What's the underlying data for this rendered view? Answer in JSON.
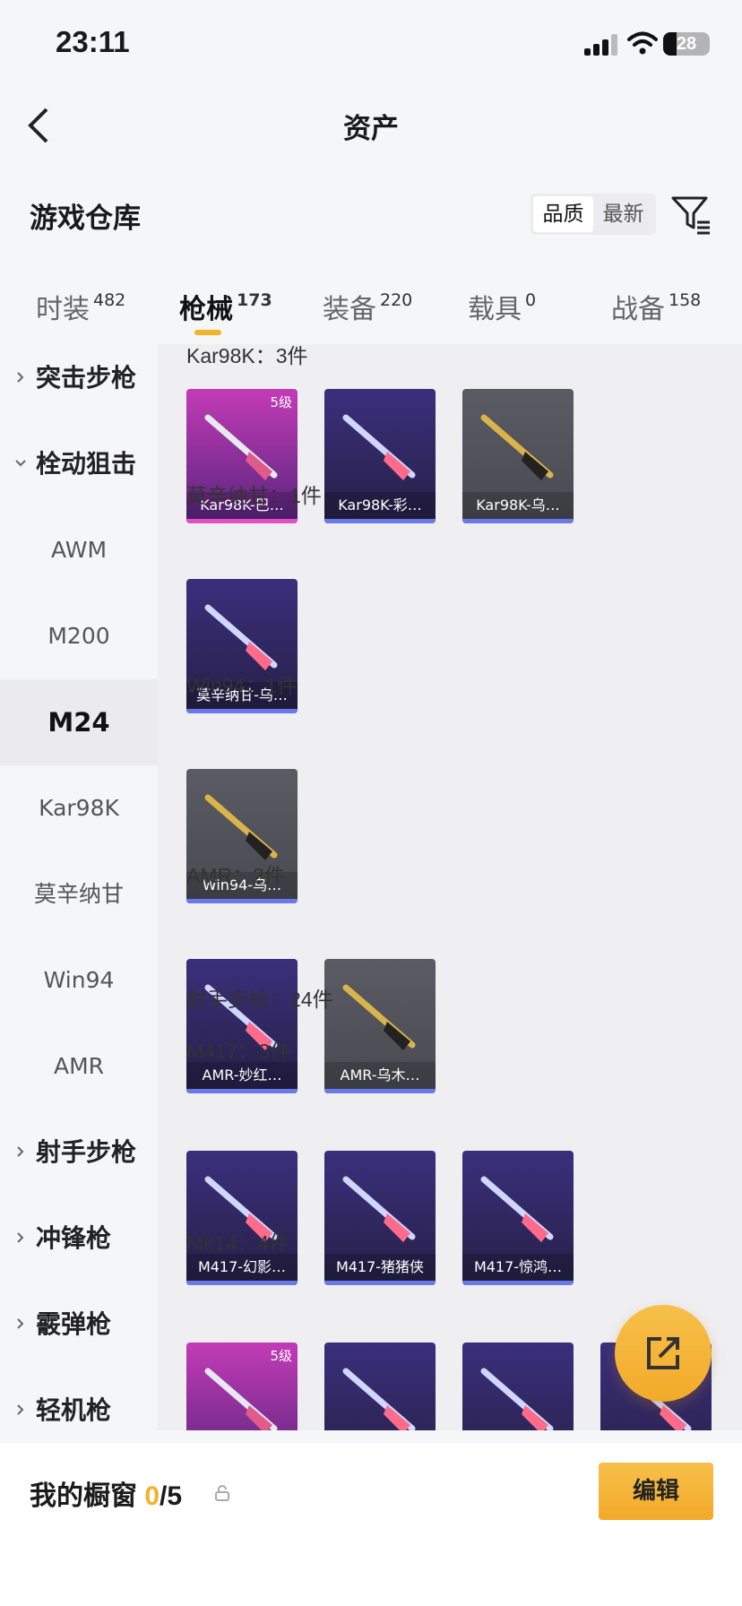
{
  "status": {
    "time": "23:11",
    "battery": "28",
    "battery_level": 0.28
  },
  "nav": {
    "title": "资产"
  },
  "section": {
    "title": "游戏仓库",
    "sort_options": [
      "品质",
      "最新"
    ],
    "sort_selected": "品质"
  },
  "tabs": [
    {
      "label": "时装",
      "count": "482"
    },
    {
      "label": "枪械",
      "count": "173",
      "active": true
    },
    {
      "label": "装备",
      "count": "220"
    },
    {
      "label": "载具",
      "count": "0"
    },
    {
      "label": "战备",
      "count": "158"
    }
  ],
  "sidebar": {
    "items": [
      {
        "label": "突击步枪",
        "type": "group",
        "expanded": false
      },
      {
        "label": "栓动狙击",
        "type": "group",
        "expanded": true
      },
      {
        "label": "AWM",
        "type": "sub"
      },
      {
        "label": "M200",
        "type": "sub"
      },
      {
        "label": "M24",
        "type": "sub",
        "selected": true
      },
      {
        "label": "Kar98K",
        "type": "sub"
      },
      {
        "label": "莫辛纳甘",
        "type": "sub"
      },
      {
        "label": "Win94",
        "type": "sub"
      },
      {
        "label": "AMR",
        "type": "sub"
      },
      {
        "label": "射手步枪",
        "type": "group",
        "expanded": false
      },
      {
        "label": "冲锋枪",
        "type": "group",
        "expanded": false
      },
      {
        "label": "霰弹枪",
        "type": "group",
        "expanded": false
      },
      {
        "label": "轻机枪",
        "type": "group",
        "expanded": false
      }
    ]
  },
  "content": {
    "groups": [
      {
        "title": "Kar98K：3件",
        "items": [
          {
            "label": "Kar98K-巴…",
            "level": "5级",
            "quality": "pink"
          },
          {
            "label": "Kar98K-彩…",
            "quality": "purple"
          },
          {
            "label": "Kar98K-乌…",
            "quality": "gray"
          }
        ]
      },
      {
        "title": "莫辛纳甘：1件",
        "items": [
          {
            "label": "莫辛纳甘-乌…",
            "quality": "purple"
          }
        ]
      },
      {
        "title": "Win94：1件",
        "items": [
          {
            "label": "Win94-乌…",
            "quality": "gray"
          }
        ]
      },
      {
        "title": "AMR：2件",
        "items": [
          {
            "label": "AMR-妙红…",
            "quality": "purple"
          },
          {
            "label": "AMR-乌木…",
            "quality": "gray"
          }
        ]
      },
      {
        "title": "射手步枪：24件",
        "items": []
      },
      {
        "title": "M417：3件",
        "items": [
          {
            "label": "M417-幻影…",
            "quality": "purple"
          },
          {
            "label": "M417-猪猪侠",
            "quality": "purple"
          },
          {
            "label": "M417-惊鸿…",
            "quality": "purple"
          }
        ]
      },
      {
        "title": "Mk14：4件",
        "items": [
          {
            "label": "",
            "level": "5级",
            "quality": "pink"
          },
          {
            "label": "",
            "quality": "purple"
          },
          {
            "label": "",
            "quality": "purple"
          },
          {
            "label": "",
            "quality": "purple"
          }
        ]
      }
    ]
  },
  "bottom": {
    "title": "我的橱窗",
    "count": "0",
    "total": "/5",
    "edit_label": "编辑"
  },
  "colors": {
    "accent": "#f2b32b",
    "pink": "#e04fc7",
    "blue_bar": "#6a79ea"
  }
}
